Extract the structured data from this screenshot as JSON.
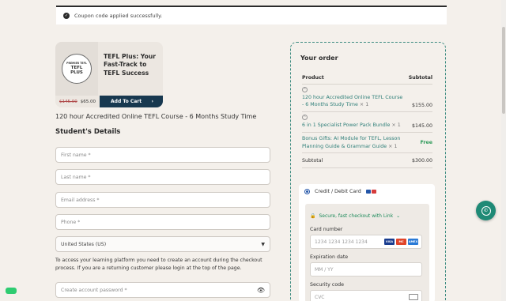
{
  "notice": {
    "text": "Coupon code applied successfully."
  },
  "product": {
    "badge_top": "PREMIER TEFL",
    "badge_main": "TEFL PLUS",
    "title": "TEFL Plus: Your Fast-Track to TEFL Success",
    "old_price": "$145.00",
    "new_price": "$65.00",
    "cta": "Add To Cart"
  },
  "course_name": "120 hour Accredited Online TEFL Course - 6 Months Study Time",
  "student_details": {
    "heading": "Student's Details",
    "first_name": "First name *",
    "last_name": "Last name *",
    "email": "Email address *",
    "phone": "Phone *",
    "country": "United States (US)",
    "account_note": "To access your learning platform you need to create an account during the checkout process. If you are a returning customer please login at the top of the page.",
    "password": "Create account password *"
  },
  "order": {
    "heading": "Your order",
    "col_product": "Product",
    "col_subtotal": "Subtotal",
    "items": [
      {
        "name": "120 hour Accredited Online TEFL Course - 6 Months Study Time",
        "qty": "× 1",
        "price": "$155.00"
      },
      {
        "name": "6 in 1 Specialist Power Pack Bundle",
        "qty": "× 1",
        "price": "$145.00"
      },
      {
        "name": "Bonus Gifts: AI Module for TEFL, Lesson Planning Guide & Grammar Guide",
        "qty": "× 1",
        "price": "Free"
      }
    ],
    "subtotal_label": "Subtotal",
    "subtotal_value": "$300.00"
  },
  "payment": {
    "method": "Credit / Debit Card",
    "link_text": "Secure, fast checkout with Link",
    "card_label": "Card number",
    "card_placeholder": "1234 1234 1234 1234",
    "exp_label": "Expiration date",
    "exp_placeholder": "MM / YY",
    "cvc_label": "Security code",
    "cvc_placeholder": "CVC",
    "brands": [
      "VISA",
      "MC",
      "AMEX"
    ]
  },
  "colors": {
    "accent": "#2f7f79",
    "navy": "#17384f",
    "whatsapp": "#1f8a76"
  }
}
